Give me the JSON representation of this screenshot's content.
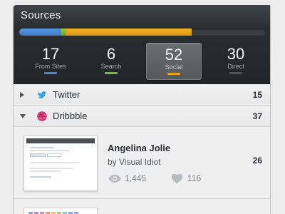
{
  "header": {
    "title": "Sources"
  },
  "colors": {
    "blue": "#4a86d6",
    "green": "#7cba2f",
    "orange": "#e3a21a",
    "track": "#3a3e42"
  },
  "progress": [
    {
      "name": "From Sites",
      "fraction": 0.17,
      "color": "#4a86d6"
    },
    {
      "name": "Search",
      "fraction": 0.06,
      "color": "#7cba2f"
    },
    {
      "name": "Social",
      "fraction": 0.52,
      "color": "#e3a21a"
    },
    {
      "name": "Direct",
      "fraction": 0.3,
      "color": "#3a3e42"
    }
  ],
  "stats": [
    {
      "value": "17",
      "label": "From Sites",
      "color": "#4a86d6",
      "active": false
    },
    {
      "value": "6",
      "label": "Search",
      "color": "#7cba2f",
      "active": false
    },
    {
      "value": "52",
      "label": "Social",
      "color": "#e3a21a",
      "active": true
    },
    {
      "value": "30",
      "label": "Direct",
      "color": "#4c5155",
      "active": false
    }
  ],
  "sources": [
    {
      "name": "Twitter",
      "count": "15",
      "expanded": false,
      "icon": "twitter-bird-icon"
    },
    {
      "name": "Dribbble",
      "count": "37",
      "expanded": true,
      "icon": "dribbble-ball-icon"
    }
  ],
  "shot": {
    "title": "Angelina Jolie",
    "by": "by Visual Idiot",
    "views": "1,445",
    "likes": "116",
    "count": "26",
    "views_icon": "eye-icon",
    "likes_icon": "heart-icon"
  }
}
